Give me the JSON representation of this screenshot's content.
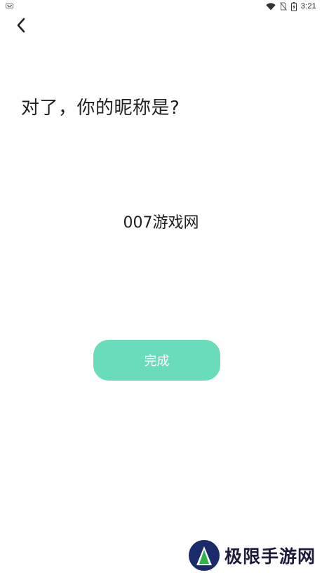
{
  "status_bar": {
    "time": "3:21",
    "icons": [
      "keyboard-icon",
      "wifi-icon",
      "no-sim-icon",
      "battery-charging-icon"
    ]
  },
  "header": {
    "back_icon": "chevron-left-icon"
  },
  "main": {
    "title": "对了，你的昵称是?",
    "nickname_value": "007游戏网",
    "done_label": "完成"
  },
  "colors": {
    "accent": "#6adcbb",
    "button_text": "#ffffff",
    "text": "#1f1f1f",
    "watermark_blue": "#1a2a6b",
    "watermark_green": "#2eb34a"
  },
  "watermark": {
    "text": "极限手游网"
  }
}
